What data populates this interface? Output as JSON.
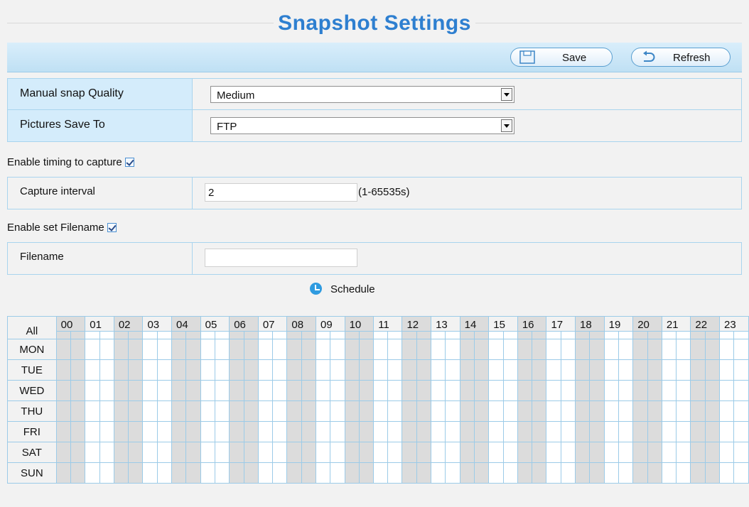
{
  "page": {
    "title": "Snapshot Settings"
  },
  "toolbar": {
    "save_label": "Save",
    "refresh_label": "Refresh"
  },
  "form": {
    "quality": {
      "label": "Manual snap Quality",
      "value": "Medium"
    },
    "save_to": {
      "label": "Pictures Save To",
      "value": "FTP"
    },
    "timing": {
      "label": "Enable timing to capture",
      "checked": true
    },
    "interval": {
      "label": "Capture interval",
      "value": "2",
      "hint": "(1-65535s)"
    },
    "filename_toggle": {
      "label": "Enable set Filename",
      "checked": true
    },
    "filename": {
      "label": "Filename",
      "value": ""
    }
  },
  "schedule": {
    "title": "Schedule",
    "all_label": "All",
    "hours": [
      "00",
      "01",
      "02",
      "03",
      "04",
      "05",
      "06",
      "07",
      "08",
      "09",
      "10",
      "11",
      "12",
      "13",
      "14",
      "15",
      "16",
      "17",
      "18",
      "19",
      "20",
      "21",
      "22",
      "23"
    ],
    "days": [
      "MON",
      "TUE",
      "WED",
      "THU",
      "FRI",
      "SAT",
      "SUN"
    ]
  },
  "colors": {
    "title": "#2e7fd0",
    "label_bg": "#d4ecfb",
    "grid_line": "#9ccbe8",
    "shaded_cell": "#dcdcdc"
  }
}
